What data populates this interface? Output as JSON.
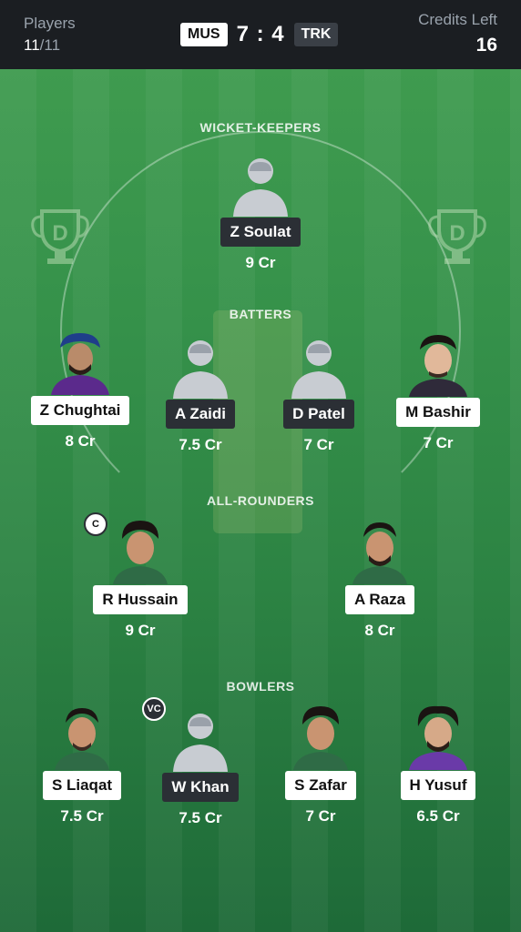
{
  "header": {
    "players_label": "Players",
    "players_selected": "11",
    "players_total": "/11",
    "team_a": "MUS",
    "score": "7 : 4",
    "team_b": "TRK",
    "credits_label": "Credits Left",
    "credits_value": "16"
  },
  "sections": {
    "wicket_keepers": "WICKET-KEEPERS",
    "batters": "BATTERS",
    "all_rounders": "ALL-ROUNDERS",
    "bowlers": "BOWLERS"
  },
  "badges": {
    "captain": "C",
    "vice_captain": "VC"
  },
  "players": {
    "wk": [
      {
        "name": "Z Soulat",
        "credits": "9 Cr",
        "team": "TRK",
        "avatar": "placeholder-avatar"
      }
    ],
    "batters": [
      {
        "name": "Z Chughtai",
        "credits": "8 Cr",
        "team": "MUS",
        "avatar": "player-photo"
      },
      {
        "name": "A Zaidi",
        "credits": "7.5 Cr",
        "team": "TRK",
        "avatar": "placeholder-avatar"
      },
      {
        "name": "D Patel",
        "credits": "7 Cr",
        "team": "TRK",
        "avatar": "placeholder-avatar"
      },
      {
        "name": "M Bashir",
        "credits": "7 Cr",
        "team": "MUS",
        "avatar": "player-photo"
      }
    ],
    "all_rounders": [
      {
        "name": "R Hussain",
        "credits": "9 Cr",
        "team": "MUS",
        "avatar": "player-photo"
      },
      {
        "name": "A Raza",
        "credits": "8 Cr",
        "team": "MUS",
        "avatar": "player-photo"
      }
    ],
    "bowlers": [
      {
        "name": "S Liaqat",
        "credits": "7.5 Cr",
        "team": "MUS",
        "avatar": "player-photo"
      },
      {
        "name": "W Khan",
        "credits": "7.5 Cr",
        "team": "TRK",
        "avatar": "placeholder-avatar"
      },
      {
        "name": "S Zafar",
        "credits": "7 Cr",
        "team": "MUS",
        "avatar": "player-photo"
      },
      {
        "name": "H Yusuf",
        "credits": "6.5 Cr",
        "team": "MUS",
        "avatar": "player-photo"
      }
    ]
  },
  "colors": {
    "header_bg": "#1b1e22",
    "field_green": "#35914a",
    "tag_dark": "#2b2f35",
    "tag_light": "#ffffff"
  }
}
